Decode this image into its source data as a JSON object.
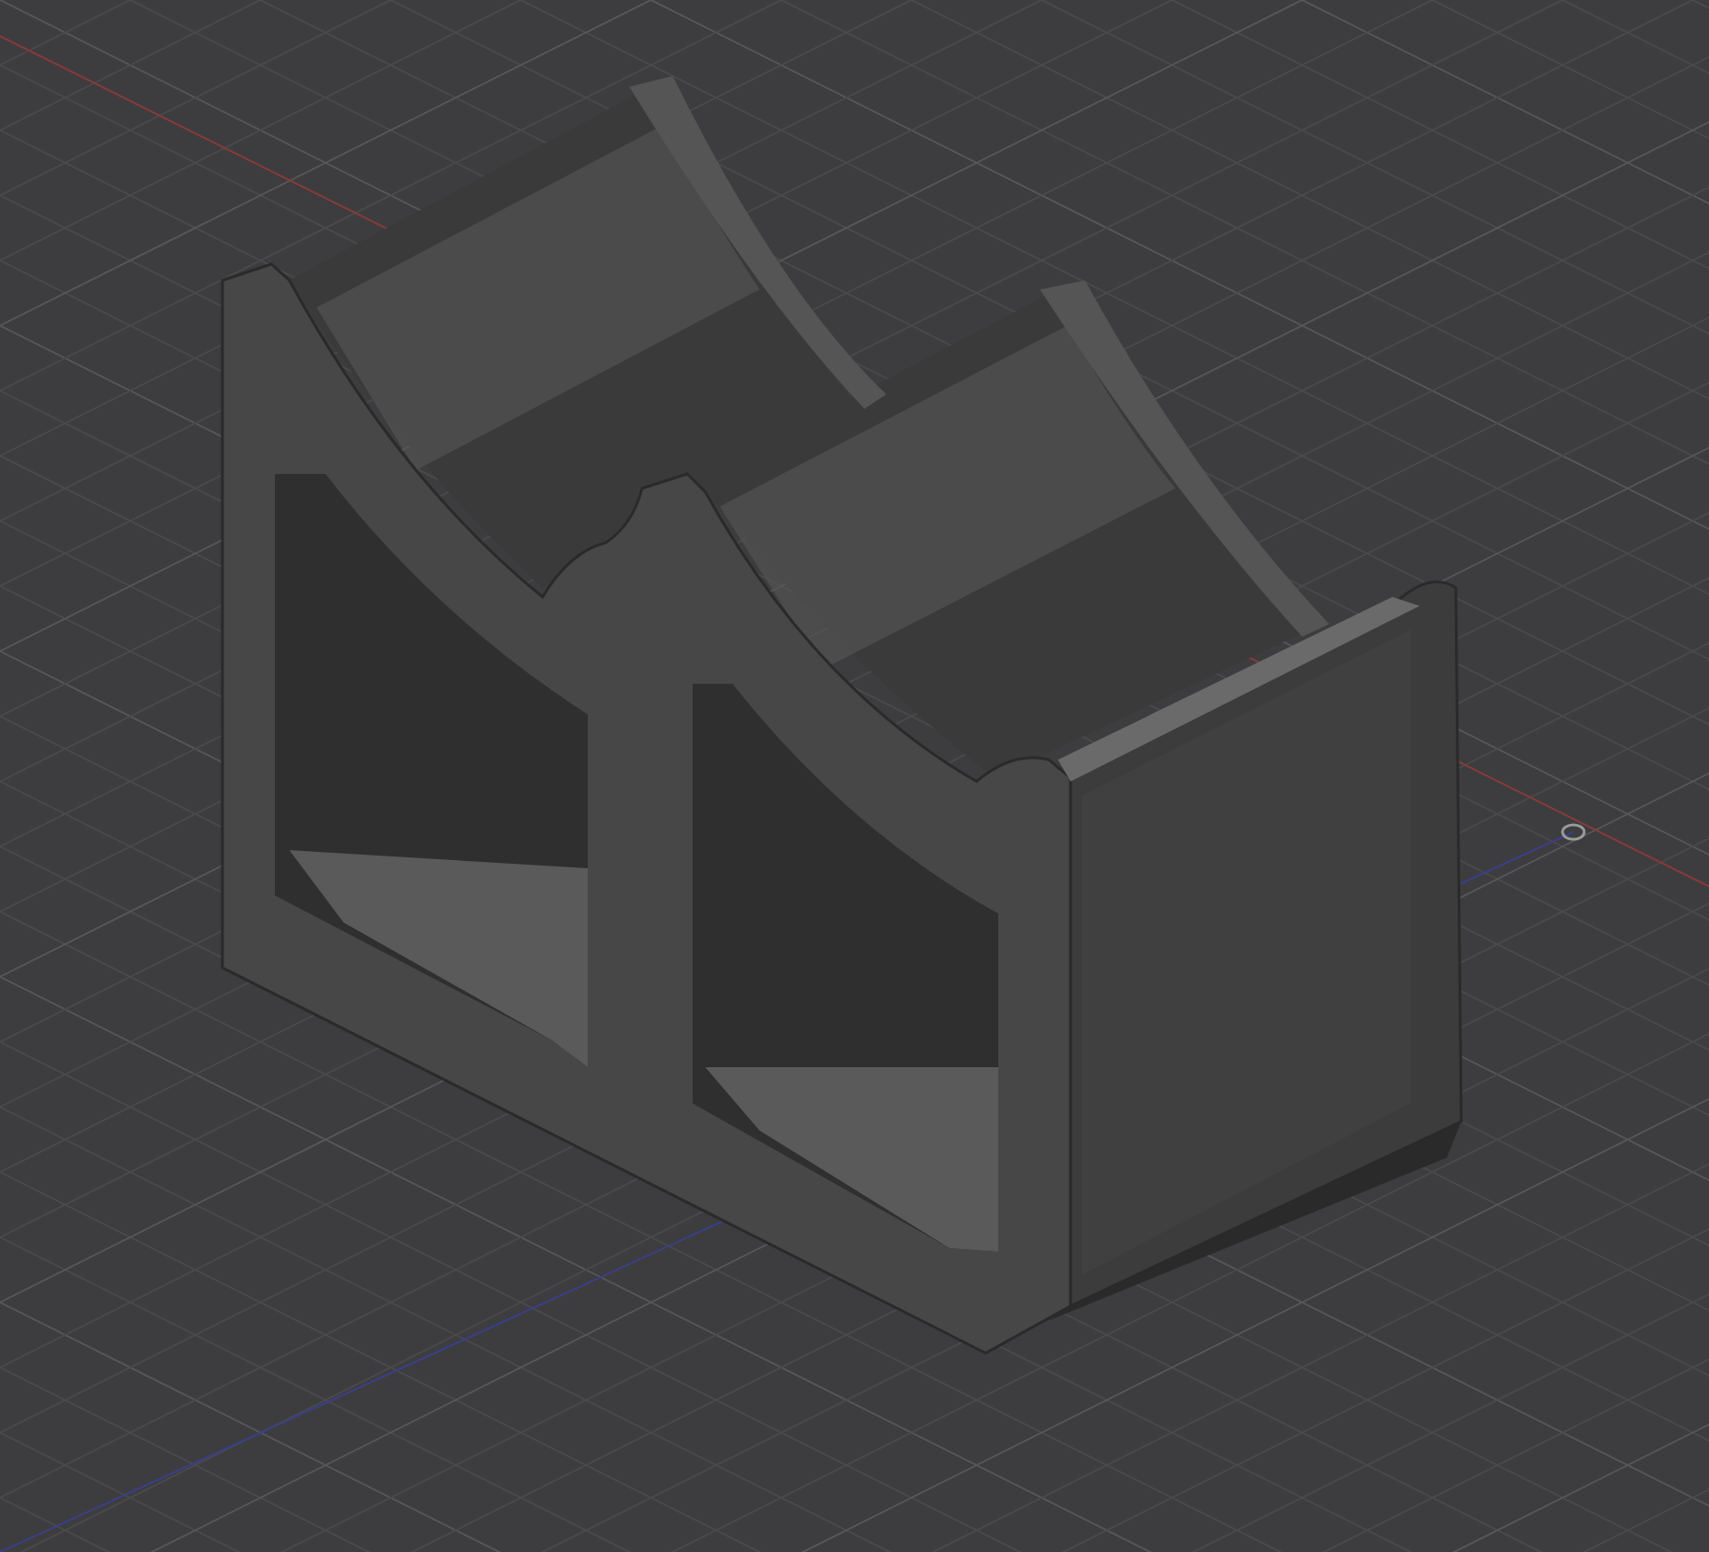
{
  "viewport": {
    "kind": "cad-3d",
    "model": {
      "kind": "double-spool-holder"
    }
  }
}
